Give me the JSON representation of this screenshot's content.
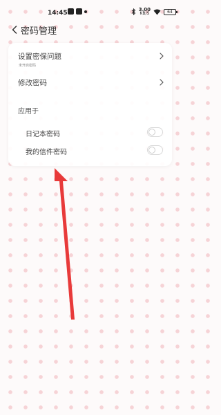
{
  "status_bar": {
    "time": "14:45",
    "net_speed": "3.00",
    "net_unit": "KB/S",
    "battery": "64"
  },
  "header": {
    "title": "密码管理"
  },
  "settings": {
    "security_question": {
      "label": "设置密保问题",
      "sublabel": "未开启密码"
    },
    "change_password": {
      "label": "修改密码"
    },
    "apply_to": {
      "label": "应用于",
      "items": [
        {
          "label": "日记本密码",
          "enabled": false
        },
        {
          "label": "我的信件密码",
          "enabled": false
        }
      ]
    }
  },
  "colors": {
    "background_dots": "#f6d3d6",
    "annotation_arrow": "#e83a3a"
  }
}
